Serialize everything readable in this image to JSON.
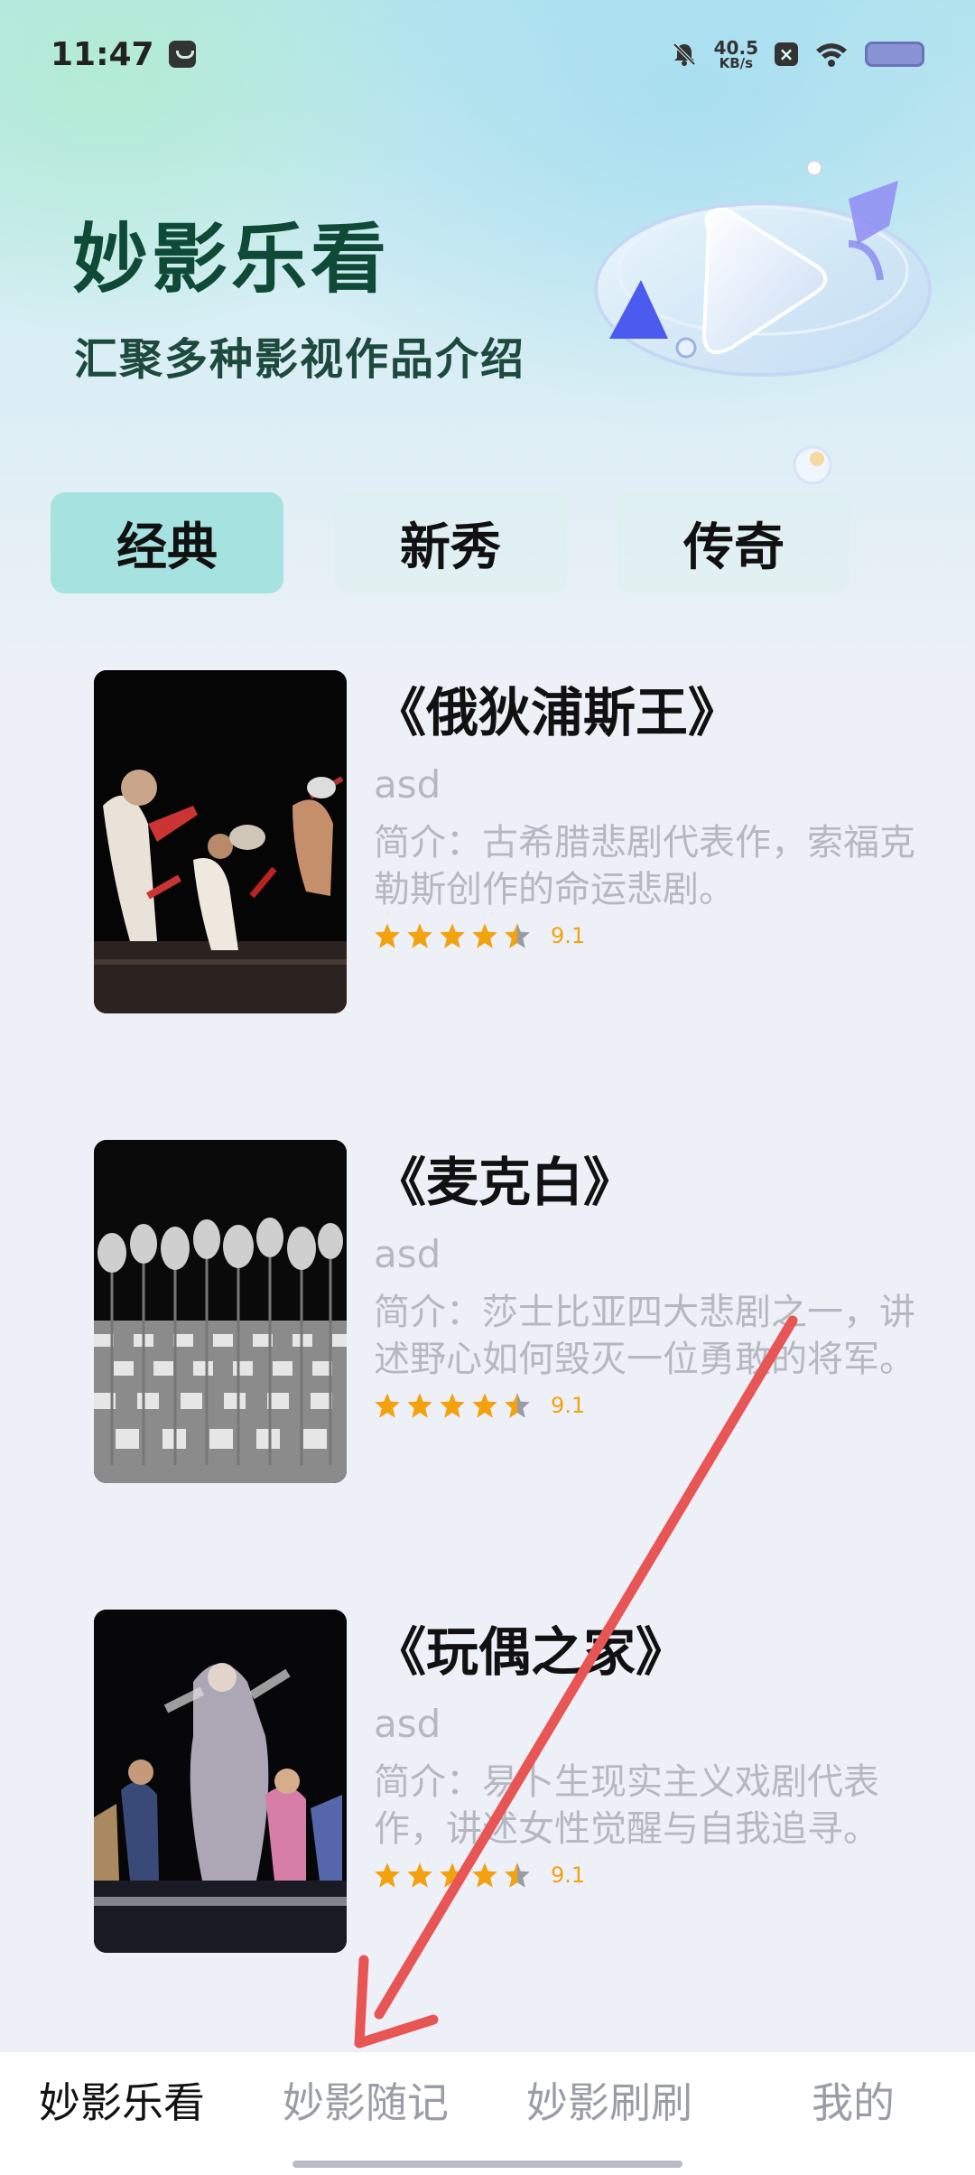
{
  "status": {
    "time": "11:47",
    "net_speed": "40.5",
    "net_unit": "KB/s"
  },
  "hero": {
    "title": "妙影乐看",
    "subtitle": "汇聚多种影视作品介绍"
  },
  "tabs": [
    {
      "label": "经典",
      "active": true
    },
    {
      "label": "新秀",
      "active": false
    },
    {
      "label": "传奇",
      "active": false
    }
  ],
  "cards": [
    {
      "title": "《俄狄浦斯王》",
      "author": "asd",
      "desc": "简介：古希腊悲剧代表作，索福克勒斯创作的命运悲剧。",
      "rating": 4.5,
      "score": "9.1"
    },
    {
      "title": "《麦克白》",
      "author": "asd",
      "desc": "简介：莎士比亚四大悲剧之一，讲述野心如何毁灭一位勇敢的将军。",
      "rating": 4.5,
      "score": "9.1"
    },
    {
      "title": "《玩偶之家》",
      "author": "asd",
      "desc": "简介：易卜生现实主义戏剧代表作，讲述女性觉醒与自我追寻。",
      "rating": 4.5,
      "score": "9.1"
    }
  ],
  "bottom_nav": [
    {
      "label": "妙影乐看",
      "active": true
    },
    {
      "label": "妙影随记",
      "active": false
    },
    {
      "label": "妙影刷刷",
      "active": false
    },
    {
      "label": "我的",
      "active": false
    }
  ],
  "colors": {
    "accent_tab": "#a6e2df",
    "star": "#f2a20f",
    "arrow": "#e85555"
  }
}
